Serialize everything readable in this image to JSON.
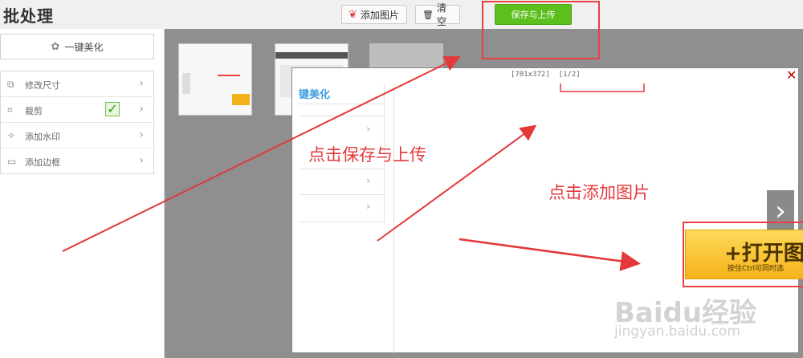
{
  "app": {
    "title": "批处理"
  },
  "toolbar": {
    "add_label": "添加图片",
    "clear_label": "清空",
    "save_label": "保存与上传"
  },
  "sidebar": {
    "one_click": "一键美化",
    "items": [
      {
        "label": "修改尺寸",
        "icon": "resize-icon"
      },
      {
        "label": "裁剪",
        "icon": "crop-icon",
        "checked": true
      },
      {
        "label": "添加水印",
        "icon": "watermark-icon"
      },
      {
        "label": "添加边框",
        "icon": "border-icon"
      }
    ]
  },
  "popup": {
    "dimensions": "[701x372]",
    "page": "[1/2]",
    "inner_title": "键美化",
    "open_button": "+打开图",
    "open_hint": "按住Ctrl可同时选"
  },
  "annotations": {
    "save_hint": "点击保存与上传",
    "add_hint": "点击添加图片"
  },
  "watermark": {
    "brand": "Baidu经验",
    "url": "jingyan.baidu.com"
  },
  "colors": {
    "save_green": "#5cbf1d",
    "annotation_red": "#e4383b",
    "link_blue": "#3c9ee0",
    "close_red": "#c00000"
  }
}
